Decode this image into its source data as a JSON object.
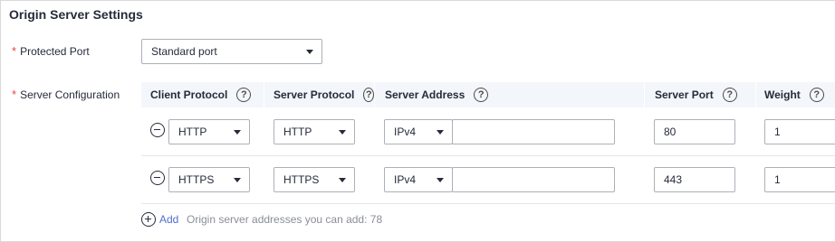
{
  "panel": {
    "title": "Origin Server Settings"
  },
  "protected_port": {
    "label": "Protected Port",
    "required_mark": "*",
    "value": "Standard port"
  },
  "server_config": {
    "label": "Server Configuration",
    "required_mark": "*",
    "headers": {
      "client_protocol": "Client Protocol",
      "server_protocol": "Server Protocol",
      "server_address": "Server Address",
      "server_port": "Server Port",
      "weight": "Weight"
    },
    "help_glyph": "?",
    "rows": [
      {
        "client_protocol": "HTTP",
        "server_protocol": "HTTP",
        "ip_version": "IPv4",
        "address": "",
        "port": "80",
        "weight": "1"
      },
      {
        "client_protocol": "HTTPS",
        "server_protocol": "HTTPS",
        "ip_version": "IPv4",
        "address": "",
        "port": "443",
        "weight": "1"
      }
    ],
    "add_label": "Add",
    "add_hint": "Origin server addresses you can add: 78"
  }
}
